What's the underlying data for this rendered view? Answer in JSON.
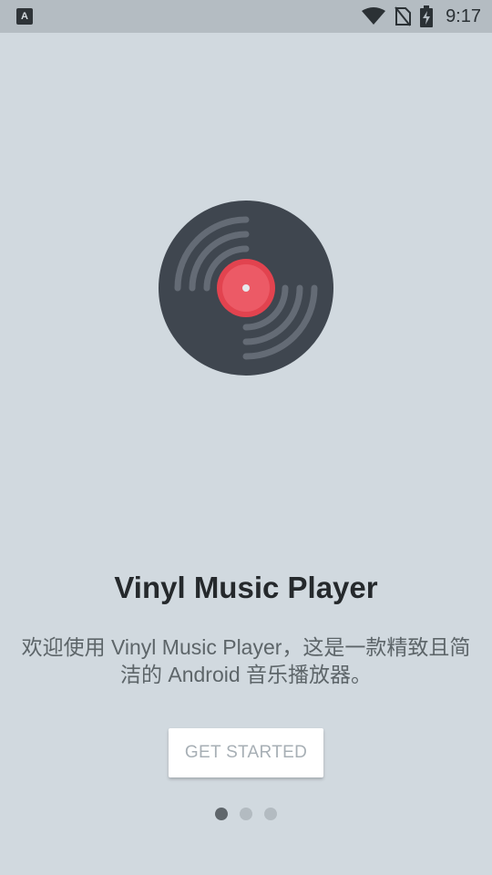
{
  "status_bar": {
    "app_badge": "A",
    "time": "9:17",
    "icons": [
      "wifi-icon",
      "no-sim-icon",
      "battery-charging-icon"
    ]
  },
  "onboarding": {
    "title": "Vinyl Music Player",
    "description": "欢迎使用 Vinyl Music Player，这是一款精致且简洁的 Android 音乐播放器。",
    "button_label": "GET STARTED",
    "page_count": 3,
    "active_page": 1
  },
  "colors": {
    "background": "#d1d9df",
    "status_bar": "#b4bcc2",
    "record": "#3f464f",
    "record_label": "#e2434f",
    "grooves": "#646b75"
  }
}
